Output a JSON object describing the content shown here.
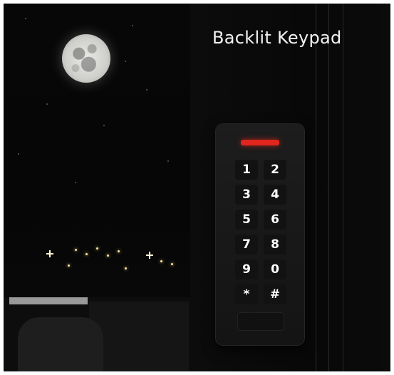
{
  "headline": "Backlit Keypad",
  "keys": [
    "1",
    "2",
    "3",
    "4",
    "5",
    "6",
    "7",
    "8",
    "9",
    "0",
    "*",
    "#"
  ],
  "colors": {
    "background": "#050505",
    "indicator": "#e0261d",
    "key_text": "#ffffff"
  }
}
